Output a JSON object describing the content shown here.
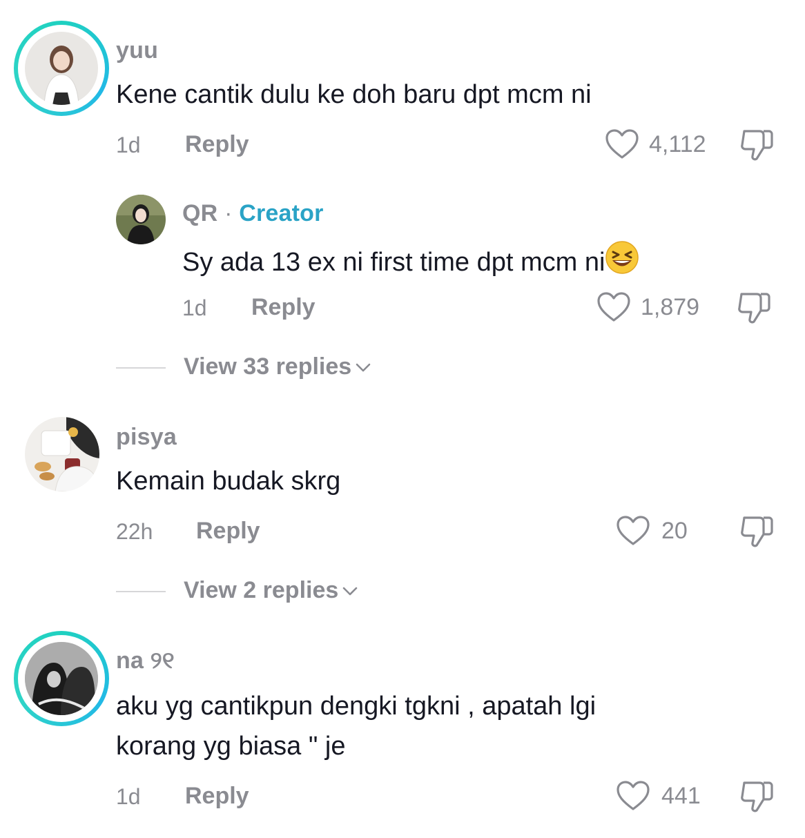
{
  "comments": [
    {
      "username": "yuu",
      "text": "Kene cantik dulu ke doh baru dpt mcm ni",
      "time": "1d",
      "reply_label": "Reply",
      "likes": "4,112",
      "avatar_icon": "avatar-photo"
    },
    {
      "username": "QR",
      "badge_separator": "·",
      "badge": "Creator",
      "text": "Sy ada 13 ex ni first time dpt mcm ni",
      "emoji_icon": "laughing-face-emoji",
      "time": "1d",
      "reply_label": "Reply",
      "likes": "1,879",
      "view_replies": "View 33 replies"
    },
    {
      "username": "pisya",
      "text": "Kemain budak skrg",
      "time": "22h",
      "reply_label": "Reply",
      "likes": "20",
      "view_replies": "View 2 replies"
    },
    {
      "username": "na ୨୧",
      "text_line1": "aku yg cantikpun dengki tgkni , apatah lgi",
      "text_line2": "korang yg biasa \" je",
      "time": "1d",
      "reply_label": "Reply",
      "likes": "441"
    }
  ],
  "colors": {
    "muted": "#8a8b91",
    "creator_accent": "#2aa3c6",
    "story_ring": "#1fd1c0"
  }
}
